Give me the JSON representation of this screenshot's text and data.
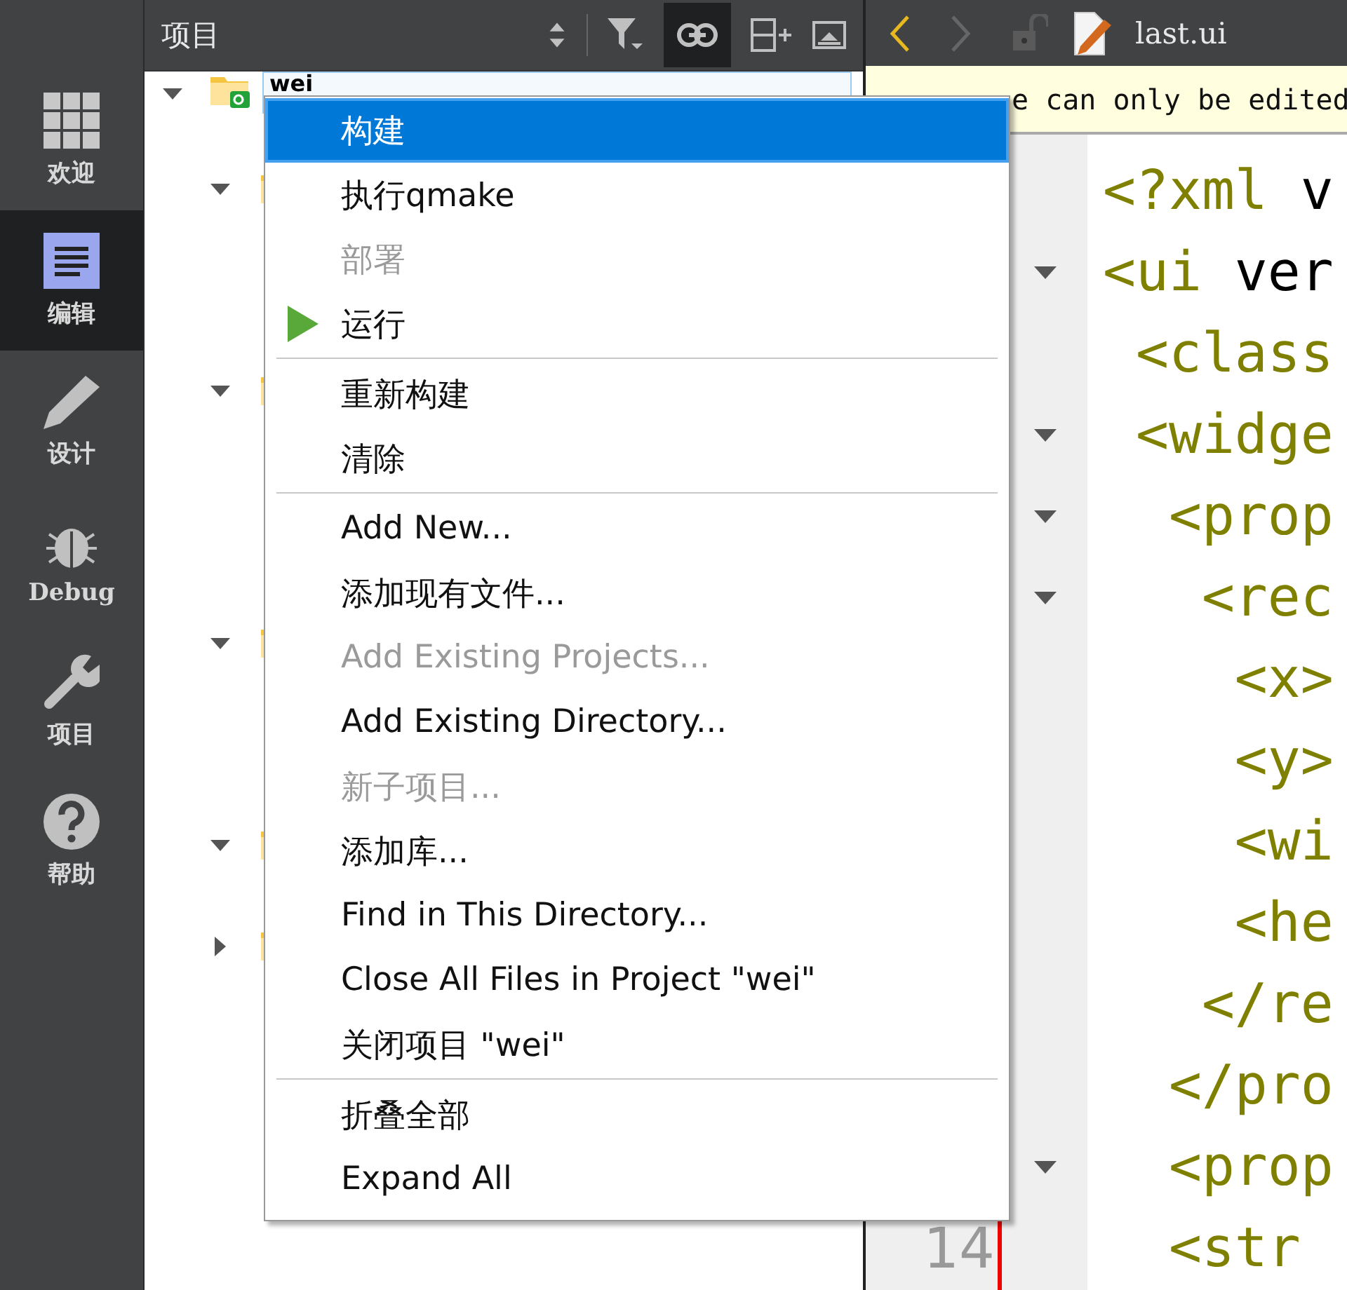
{
  "mode_bar": [
    {
      "label": "欢迎",
      "selected": false
    },
    {
      "label": "编辑",
      "selected": true
    },
    {
      "label": "设计",
      "selected": false
    },
    {
      "label": "Debug",
      "selected": false
    },
    {
      "label": "项目",
      "selected": false
    },
    {
      "label": "帮助",
      "selected": false
    }
  ],
  "project_panel": {
    "title": "项目",
    "link_toggled": true,
    "tree": {
      "label": "wei",
      "expanded": true,
      "children": [
        {
          "expanded": true
        },
        {
          "expanded": true
        },
        {
          "expanded": true
        },
        {
          "expanded": true
        },
        {
          "expanded": false
        }
      ]
    }
  },
  "editor": {
    "file": "last.ui",
    "back_enabled": true,
    "forward_enabled": false,
    "info_bar": "e can only be edited",
    "lines": [
      {
        "fold": false,
        "segments": [
          {
            "text": "<?xml",
            "kind": "tag"
          },
          {
            "text": " v",
            "kind": "plain"
          }
        ]
      },
      {
        "fold": true,
        "segments": [
          {
            "text": "<ui",
            "kind": "tag"
          },
          {
            "text": " ver",
            "kind": "plain"
          }
        ]
      },
      {
        "fold": false,
        "segments": [
          {
            "text": " <class",
            "kind": "tag"
          }
        ]
      },
      {
        "fold": true,
        "segments": [
          {
            "text": " <widge",
            "kind": "tag"
          }
        ]
      },
      {
        "fold": true,
        "segments": [
          {
            "text": "  <prop",
            "kind": "tag"
          }
        ]
      },
      {
        "fold": true,
        "segments": [
          {
            "text": "   <rec",
            "kind": "tag"
          }
        ]
      },
      {
        "fold": false,
        "segments": [
          {
            "text": "    <x>",
            "kind": "tag"
          }
        ]
      },
      {
        "fold": false,
        "segments": [
          {
            "text": "    <y>",
            "kind": "tag"
          }
        ]
      },
      {
        "fold": false,
        "segments": [
          {
            "text": "    <wi",
            "kind": "tag"
          }
        ]
      },
      {
        "fold": false,
        "segments": [
          {
            "text": "    <he",
            "kind": "tag"
          }
        ]
      },
      {
        "fold": false,
        "segments": [
          {
            "text": "   </re",
            "kind": "tag"
          }
        ]
      },
      {
        "fold": false,
        "segments": [
          {
            "text": "  </pro",
            "kind": "tag"
          }
        ]
      },
      {
        "fold": true,
        "segments": [
          {
            "text": "  <prop",
            "kind": "tag"
          }
        ]
      },
      {
        "fold": false,
        "number": "14",
        "segments": [
          {
            "text": "  <str",
            "kind": "tag"
          }
        ]
      }
    ]
  },
  "context_menu": [
    {
      "kind": "item",
      "label": "构建",
      "selected": true,
      "disabled": false
    },
    {
      "kind": "item",
      "label": "执行qmake",
      "selected": false,
      "disabled": false
    },
    {
      "kind": "item",
      "label": "部署",
      "selected": false,
      "disabled": true
    },
    {
      "kind": "run_item",
      "label": "运行",
      "selected": false,
      "disabled": false
    },
    {
      "kind": "separator"
    },
    {
      "kind": "item",
      "label": "重新构建",
      "selected": false,
      "disabled": false
    },
    {
      "kind": "item",
      "label": "清除",
      "selected": false,
      "disabled": false
    },
    {
      "kind": "separator"
    },
    {
      "kind": "item",
      "label": "Add New...",
      "selected": false,
      "disabled": false
    },
    {
      "kind": "item",
      "label": "添加现有文件...",
      "selected": false,
      "disabled": false
    },
    {
      "kind": "item",
      "label": "Add Existing Projects...",
      "selected": false,
      "disabled": true
    },
    {
      "kind": "item",
      "label": "Add Existing Directory...",
      "selected": false,
      "disabled": false
    },
    {
      "kind": "item",
      "label": "新子项目...",
      "selected": false,
      "disabled": true
    },
    {
      "kind": "item",
      "label": "添加库...",
      "selected": false,
      "disabled": false
    },
    {
      "kind": "item",
      "label": "Find in This Directory...",
      "selected": false,
      "disabled": false
    },
    {
      "kind": "item",
      "label": "Close All Files in Project \"wei\"",
      "selected": false,
      "disabled": false
    },
    {
      "kind": "item",
      "label": "关闭项目 \"wei\"",
      "selected": false,
      "disabled": false
    },
    {
      "kind": "separator"
    },
    {
      "kind": "item",
      "label": "折叠全部",
      "selected": false,
      "disabled": false
    },
    {
      "kind": "item",
      "label": "Expand All",
      "selected": false,
      "disabled": false
    }
  ]
}
